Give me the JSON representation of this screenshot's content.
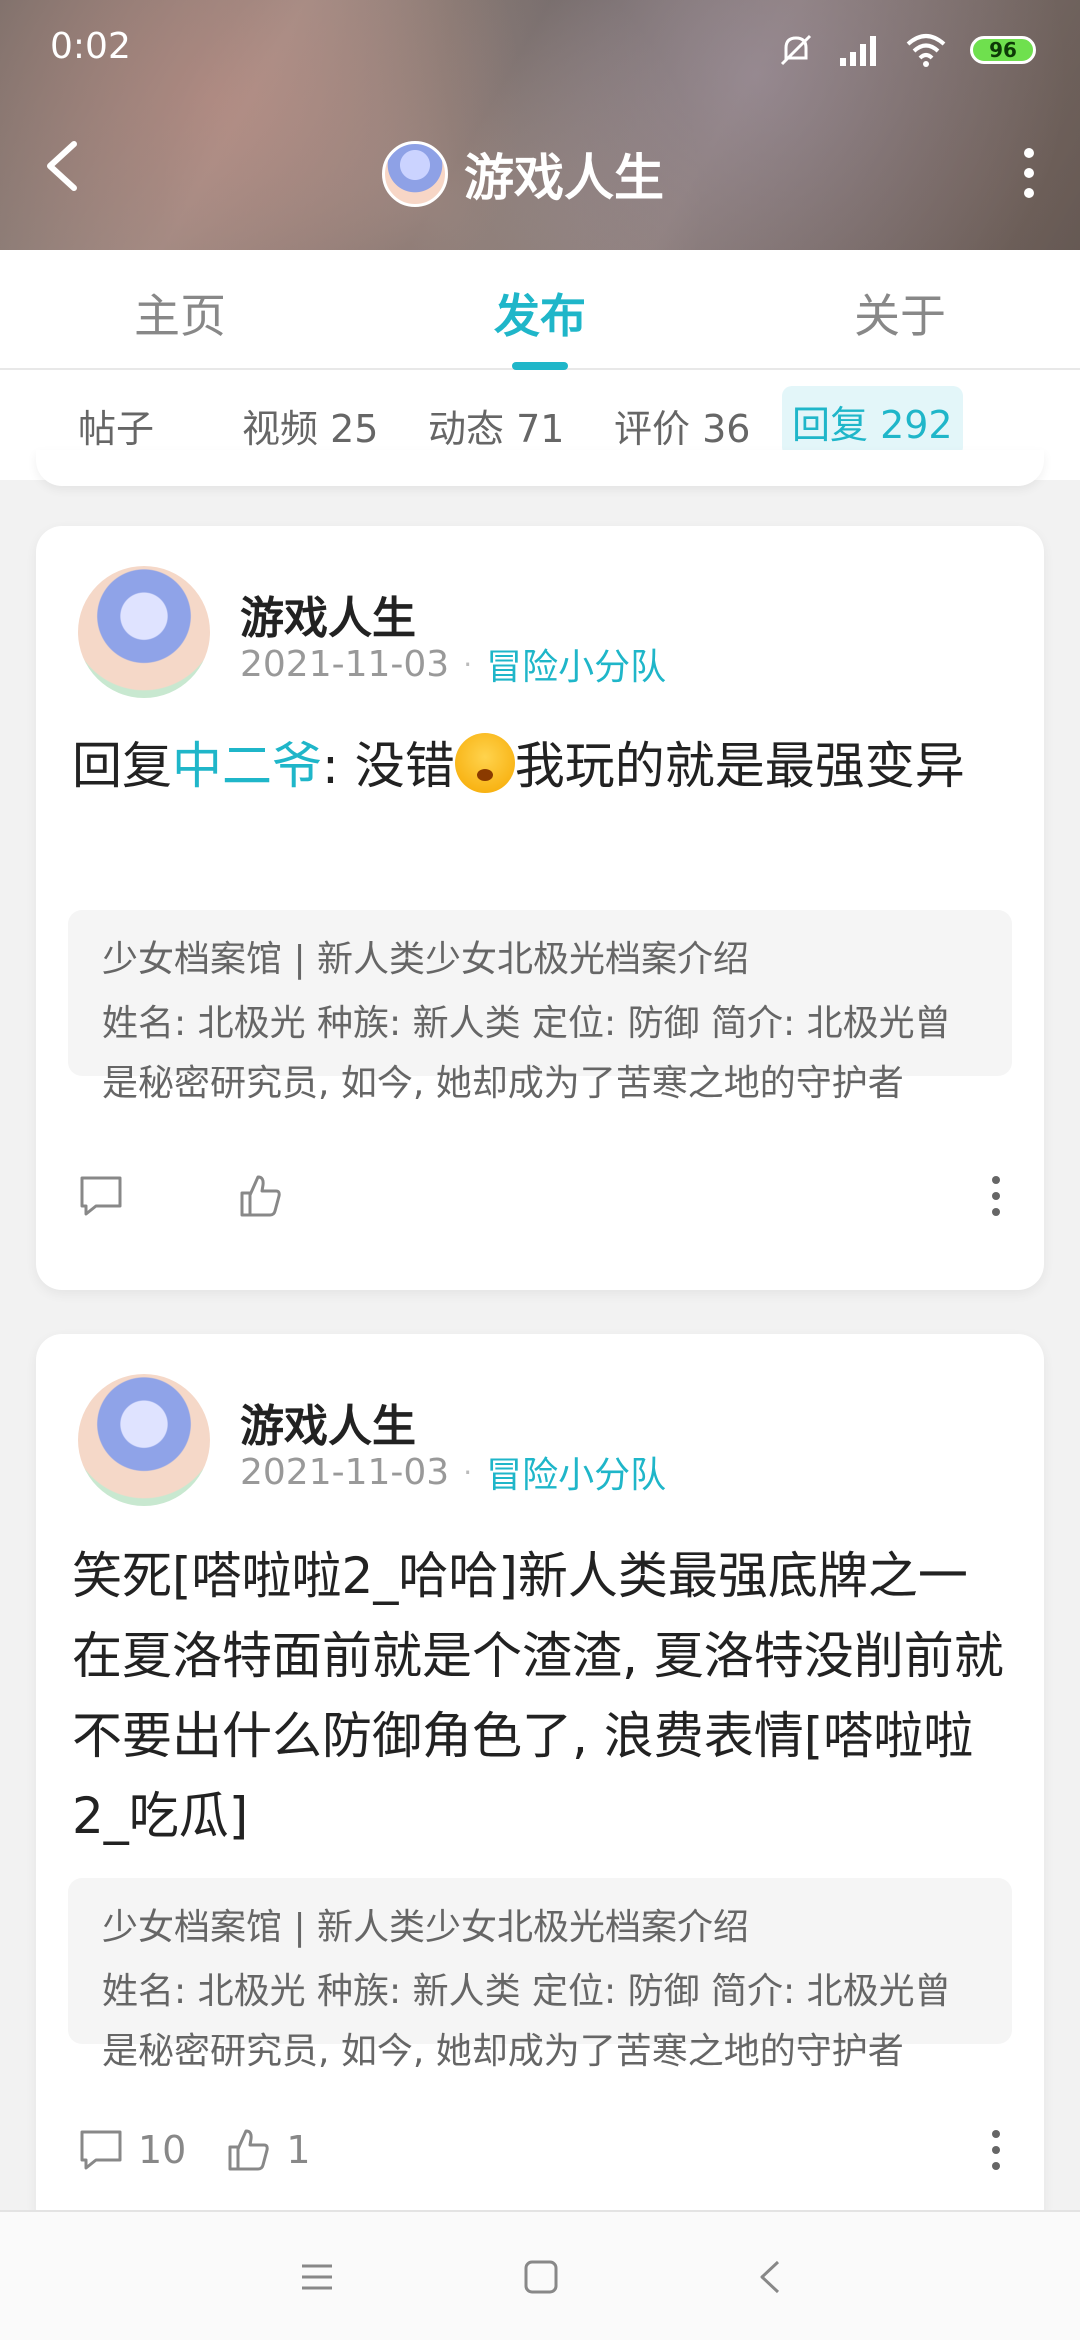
{
  "status": {
    "time": "0:02",
    "battery": "96"
  },
  "header": {
    "title": "游戏人生"
  },
  "main_tabs": [
    {
      "label": "主页"
    },
    {
      "label": "发布"
    },
    {
      "label": "关于"
    }
  ],
  "sub_tabs": [
    {
      "label": "帖子"
    },
    {
      "label": "视频 25"
    },
    {
      "label": "动态 71"
    },
    {
      "label": "评价 36"
    },
    {
      "label": "回复 292"
    }
  ],
  "posts": [
    {
      "author": "游戏人生",
      "date": "2021-11-03",
      "group": "冒险小分队",
      "reply_prefix": "回复",
      "mention": "中二爷",
      "text_before_emoji": ": 没错",
      "text_after_emoji": "我玩的就是最强变异",
      "quote_title": "少女档案馆 | 新人类少女北极光档案介绍",
      "quote_body": "姓名: 北极光 种族: 新人类 定位: 防御 简介: 北极光曾是秘密研究员, 如今, 她却成为了苦寒之地的守护者",
      "comments": "",
      "likes": ""
    },
    {
      "author": "游戏人生",
      "date": "2021-11-03",
      "group": "冒险小分队",
      "text": "笑死[嗒啦啦2_哈哈]新人类最强底牌之一在夏洛特面前就是个渣渣, 夏洛特没削前就不要出什么防御角色了, 浪费表情[嗒啦啦2_吃瓜]",
      "quote_title": "少女档案馆 | 新人类少女北极光档案介绍",
      "quote_body": "姓名: 北极光 种族: 新人类 定位: 防御 简介: 北极光曾是秘密研究员, 如今, 她却成为了苦寒之地的守护者",
      "comments": "10",
      "likes": "1"
    }
  ],
  "colors": {
    "accent": "#1fb6c9"
  }
}
